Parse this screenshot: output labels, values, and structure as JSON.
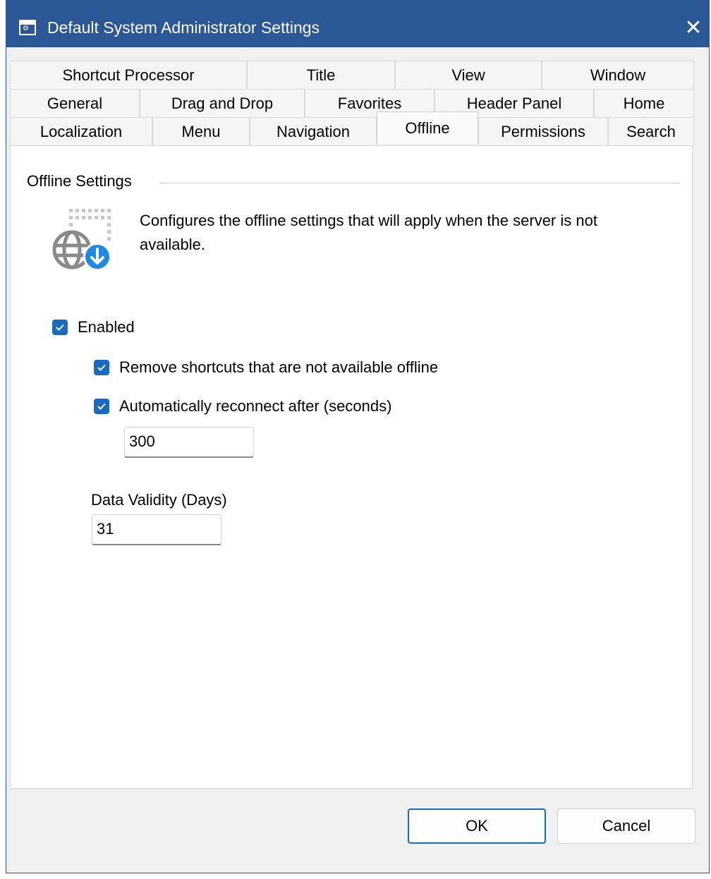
{
  "window": {
    "title": "Default System Administrator Settings",
    "close_glyph": "✕"
  },
  "tabs": {
    "row1": [
      "Shortcut Processor",
      "Title",
      "View",
      "Window"
    ],
    "row2": [
      "General",
      "Drag and Drop",
      "Favorites",
      "Header Panel",
      "Home"
    ],
    "row3": [
      "Localization",
      "Menu",
      "Navigation",
      "Offline",
      "Permissions",
      "Search"
    ],
    "active": "Offline"
  },
  "offline": {
    "group_label": "Offline Settings",
    "icon": "globe-download-icon",
    "description": "Configures the offline settings that will apply when the server is not available.",
    "enabled": {
      "label": "Enabled",
      "checked": true
    },
    "remove_shortcuts": {
      "label": "Remove shortcuts that are not available offline",
      "checked": true
    },
    "auto_reconnect": {
      "label": "Automatically reconnect after (seconds)",
      "checked": true
    },
    "reconnect_seconds": "300",
    "data_validity_label": "Data Validity (Days)",
    "data_validity_value": "31"
  },
  "buttons": {
    "ok": "OK",
    "cancel": "Cancel"
  },
  "colors": {
    "titlebar": "#2b5797",
    "accent": "#1a6bbf",
    "icon_badge": "#1e88e5"
  }
}
